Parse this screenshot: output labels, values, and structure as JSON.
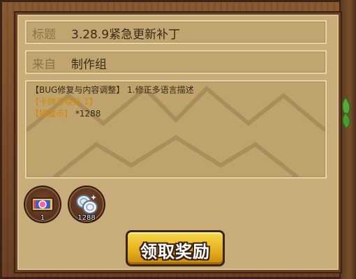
{
  "mail": {
    "title_label": "标题",
    "title_value": "3.28.9紧急更新补丁",
    "from_label": "来自",
    "from_value": "制作组",
    "body_line1": "【BUG修复与内容调整】 1.修正多语言描述",
    "body_line2": "【卡牌召唤券 1】",
    "body_line3_tag": "【猎魔币】",
    "body_line3_amount": "*1288"
  },
  "rewards": [
    {
      "icon": "card-summon-ticket-icon",
      "count": "1"
    },
    {
      "icon": "silver-coins-icon",
      "count": "1288"
    }
  ],
  "actions": {
    "claim_label": "领取奖励"
  },
  "colors": {
    "parchment": "#c8ad7a",
    "highlight_text": "#d18a10",
    "button_gold": "#f6d84a",
    "wood": "#7a4c2a"
  }
}
